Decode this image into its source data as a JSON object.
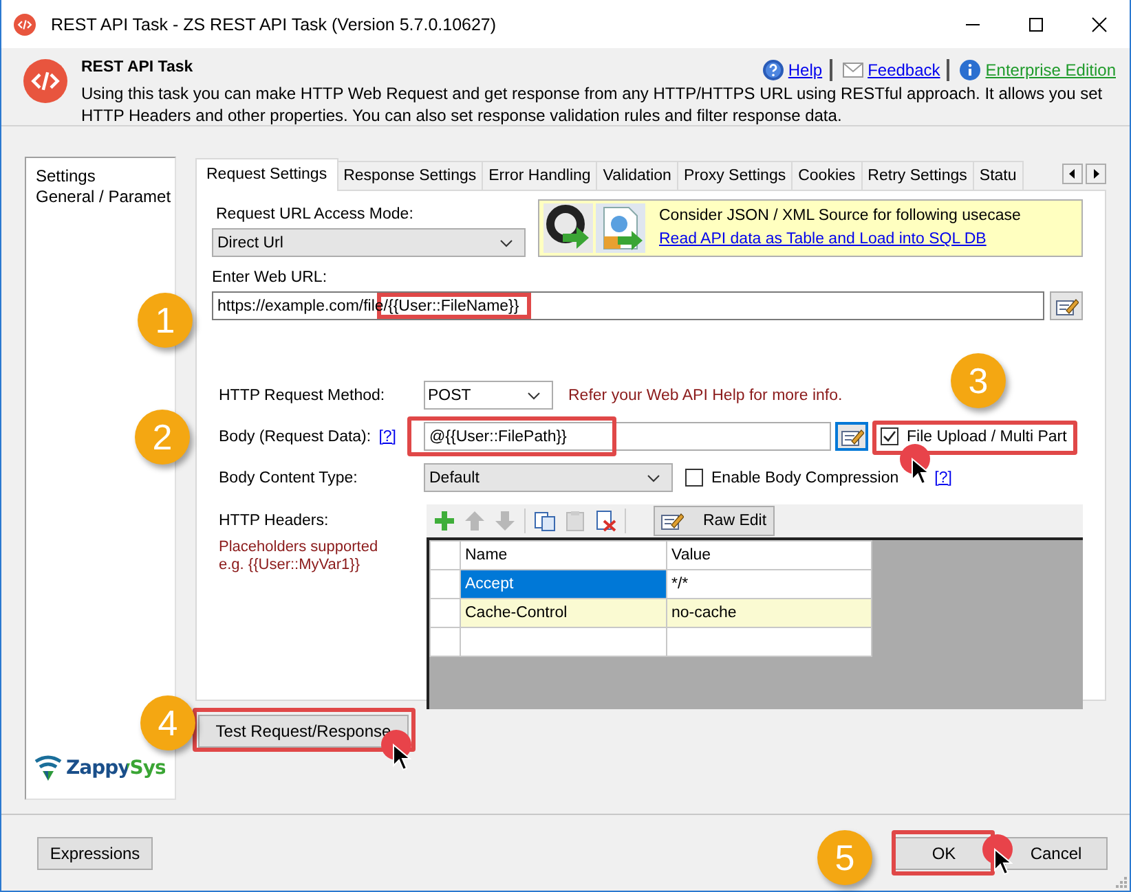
{
  "window": {
    "title": "REST API Task - ZS REST API Task (Version 5.7.0.10627)"
  },
  "header": {
    "title": "REST API Task",
    "description": "Using this task you can make HTTP Web Request and get response from any HTTP/HTTPS URL using RESTful approach. It allows you set HTTP Headers and other properties. You can also set response validation rules and filter response data.",
    "links": [
      {
        "kind": "help",
        "label": "Help"
      },
      {
        "kind": "feedback",
        "label": "Feedback"
      },
      {
        "kind": "edition",
        "label": "Enterprise Edition"
      }
    ]
  },
  "sidebar": {
    "items": [
      {
        "label": "Settings"
      },
      {
        "label": "General / Paramet"
      }
    ],
    "logo": "ZappySys"
  },
  "tabs": [
    {
      "label": "Request Settings",
      "selected": true
    },
    {
      "label": "Response Settings",
      "selected": false
    },
    {
      "label": "Error Handling",
      "selected": false
    },
    {
      "label": "Validation",
      "selected": false
    },
    {
      "label": "Proxy Settings",
      "selected": false
    },
    {
      "label": "Cookies",
      "selected": false
    },
    {
      "label": "Retry Settings",
      "selected": false
    },
    {
      "label": "Statu",
      "selected": false
    }
  ],
  "request": {
    "access_mode": {
      "label": "Request URL Access Mode:",
      "value": "Direct Url"
    },
    "promo": {
      "text": "Consider JSON / XML Source for following usecase",
      "link": "Read API data as Table and Load into SQL DB"
    },
    "web_url": {
      "label": "Enter Web URL:",
      "value": "https://example.com/file/{{User::FileName}}"
    },
    "method": {
      "label": "HTTP Request Method:",
      "value": "POST",
      "hint": "Refer your Web API Help for more info."
    },
    "body": {
      "label": "Body (Request Data):",
      "help": "[?]",
      "value": "@{{User::FilePath}}"
    },
    "file_upload": {
      "label": "File Upload / Multi Part",
      "checked": true
    },
    "content_type": {
      "label": "Body Content Type:",
      "value": "Default"
    },
    "compression": {
      "label": "Enable Body Compression",
      "checked": false,
      "help": "[?]"
    },
    "headers": {
      "label": "HTTP Headers:",
      "note": [
        "Placeholders supported",
        "e.g. {{User::MyVar1}}"
      ],
      "raw_edit": "Raw Edit",
      "columns": [
        "Name",
        "Value"
      ],
      "rows": [
        {
          "name": "Accept",
          "value": "*/*",
          "selected": true,
          "highlighted": false
        },
        {
          "name": "Cache-Control",
          "value": "no-cache",
          "selected": false,
          "highlighted": true
        }
      ]
    }
  },
  "test_button": "Test Request/Response",
  "footer": {
    "expressions": "Expressions",
    "ok": "OK",
    "cancel": "Cancel"
  },
  "callouts": [
    "1",
    "2",
    "3",
    "4",
    "5"
  ]
}
